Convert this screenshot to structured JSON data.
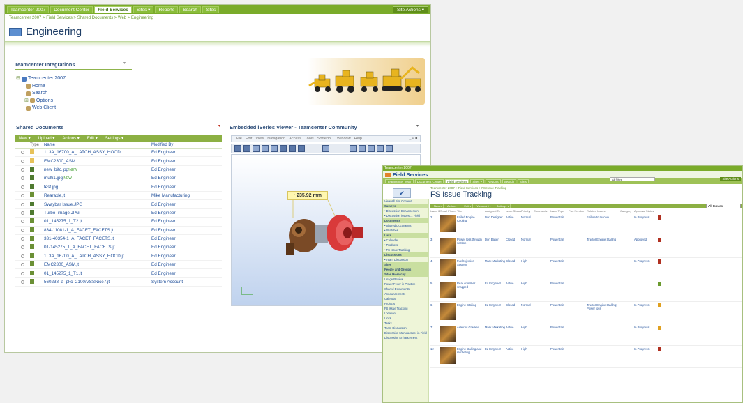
{
  "window1": {
    "top_tabs": [
      "Teamcenter 2007",
      "Document Center",
      "Field Services",
      "Sites ▾",
      "Reports",
      "Search",
      "Sites"
    ],
    "active_tab_index": 2,
    "site_actions": "Site Actions ▾",
    "breadcrumb": "Teamcenter 2007 > Field Services > Shared Documents > Web > Engineering",
    "page_title": "Engineering",
    "integrations": {
      "title": "Teamcenter Integrations",
      "tree": [
        {
          "label": "Teamcenter 2007",
          "indent": 0,
          "glyph": "⊟"
        },
        {
          "label": "Home",
          "indent": 1,
          "glyph": ""
        },
        {
          "label": "Search",
          "indent": 1,
          "glyph": ""
        },
        {
          "label": "Options",
          "indent": 1,
          "glyph": "⊞"
        },
        {
          "label": "Web Client",
          "indent": 1,
          "glyph": ""
        }
      ]
    },
    "shared_documents": {
      "title": "Shared Documents",
      "toolbar": [
        "New ▾",
        "Upload ▾",
        "Actions ▾",
        "Edit ▾",
        "Settings ▾"
      ],
      "columns": {
        "type": "Type",
        "name": "Name",
        "modified_by": "Modified By"
      },
      "rows": [
        {
          "type": "folder",
          "name": "1L3A_16700_A_LATCH_ASSY_HOOD",
          "modified_by": "Ed Engineer",
          "new": false
        },
        {
          "type": "folder",
          "name": "EMC2300_ASM",
          "modified_by": "Ed Engineer",
          "new": false
        },
        {
          "type": "doc",
          "name": "new_bitc.jpg",
          "modified_by": "Ed Engineer",
          "new": true
        },
        {
          "type": "doc",
          "name": "multi1.jpg",
          "modified_by": "Ed Engineer",
          "new": true
        },
        {
          "type": "doc",
          "name": "test.jpg",
          "modified_by": "Ed Engineer",
          "new": false
        },
        {
          "type": "jt",
          "name": "Rearaxle.jt",
          "modified_by": "Mike Manufacturing",
          "new": false
        },
        {
          "type": "doc",
          "name": "Swaybar Issue.JPG",
          "modified_by": "Ed Engineer",
          "new": false
        },
        {
          "type": "doc",
          "name": "Turbo_image.JPG",
          "modified_by": "Ed Engineer",
          "new": false
        },
        {
          "type": "jt",
          "name": "01_145275_1_T2.jt",
          "modified_by": "Ed Engineer",
          "new": false
        },
        {
          "type": "jt",
          "name": "834-11081-1_A_FACET_FACETS.jt",
          "modified_by": "Ed Engineer",
          "new": false
        },
        {
          "type": "jt",
          "name": "331-40354-1_A_FACET_FACETS.jt",
          "modified_by": "Ed Engineer",
          "new": false
        },
        {
          "type": "jt",
          "name": "01-145275_1_A_FACET_FACETS.jt",
          "modified_by": "Ed Engineer",
          "new": false
        },
        {
          "type": "jt",
          "name": "1L3A_16700_A_LATCH_ASSY_HOOD.jt",
          "modified_by": "Ed Engineer",
          "new": false
        },
        {
          "type": "jt",
          "name": "EMC2300_ASM.jt",
          "modified_by": "Ed Engineer",
          "new": false
        },
        {
          "type": "jt",
          "name": "01_145275_1_T1.jt",
          "modified_by": "Ed Engineer",
          "new": false
        },
        {
          "type": "jt",
          "name": "560238_a_pkc_2100/VSSNice7.jt",
          "modified_by": "System Account",
          "new": false
        }
      ],
      "new_marker": "!NEW"
    },
    "viewer": {
      "title": "Embedded iSeries Viewer - Teamcenter Community",
      "menu": [
        "File",
        "Edit",
        "View",
        "Navigation",
        "Access",
        "Tools",
        "Sorted3D",
        "Window",
        "Help"
      ],
      "measurement": "~235.92 mm"
    }
  },
  "window2": {
    "top_bar": "Teamcenter 2007",
    "site_title": "Field Services",
    "tabs": [
      "Teamcenter 2007",
      "Document Center",
      "Field Services",
      "Sites ▾",
      "Reports",
      "Search",
      "Sites"
    ],
    "active_tab_index": 2,
    "site_actions": "Site Actions",
    "search_scope": "All Sites",
    "breadcrumb": "Teamcenter 2007 > Field Services > FS Issue Tracking",
    "page_title": "FS Issue Tracking",
    "toolbar": [
      "New ▾",
      "Actions ▾",
      "Edit ▾",
      "Viewpoint ▾",
      "Settings ▾"
    ],
    "view_selector": "All Issues",
    "columns": [
      "Issue ID",
      "Small Photo",
      "Title",
      "Assigned To",
      "Issue Status",
      "Priority",
      "Comments",
      "Issue Type",
      "Part Number",
      "Related Issues",
      "Category",
      "Approval Status"
    ],
    "rows": [
      {
        "id": "2",
        "title": "Failed Engine Cooling",
        "assigned": "Don Designer",
        "status": "Active",
        "priority": "Normal",
        "type": "Powertrain",
        "issues": "Failure to resolve...",
        "approval": "In Progress",
        "flag": "#b03020"
      },
      {
        "id": "3",
        "title": "Power loss through section",
        "assigned": "Don Baker",
        "status": "Closed",
        "priority": "Normal",
        "type": "Powertrain",
        "issues": "Tractor Engine Stalling",
        "approval": "Approved",
        "flag": "#b03020"
      },
      {
        "id": "4",
        "title": "Fuel Injection System",
        "assigned": "Mark Marketing",
        "status": "Closed",
        "priority": "High",
        "type": "Powertrain",
        "issues": "",
        "approval": "In Progress",
        "flag": "#b03020"
      },
      {
        "id": "5",
        "title": "Rear crossbar snapped",
        "assigned": "Ed Engineer",
        "status": "Active",
        "priority": "High",
        "type": "Powertrain",
        "issues": "",
        "approval": "",
        "flag": "#6a9a2e"
      },
      {
        "id": "6",
        "title": "Engine Stalling",
        "assigned": "Ed Engineer",
        "status": "Closed",
        "priority": "Normal",
        "type": "Powertrain",
        "issues": "Tractor Engine Stalling; Power loss",
        "approval": "In Progress",
        "flag": "#e0a020"
      },
      {
        "id": "7",
        "title": "Axle rod Cracked",
        "assigned": "Mark Marketing",
        "status": "Active",
        "priority": "High",
        "type": "Powertrain",
        "issues": "",
        "approval": "In Progress",
        "flag": "#e0a020"
      },
      {
        "id": "12",
        "title": "Engine stalling and ratcheting",
        "assigned": "Ed Engineer",
        "status": "Active",
        "priority": "High",
        "type": "Powertrain",
        "issues": "",
        "approval": "In Progress",
        "flag": "#b03020"
      }
    ],
    "sidebar": [
      {
        "kind": "it",
        "label": "View All Site Content"
      },
      {
        "kind": "hd",
        "label": "Surveys"
      },
      {
        "kind": "it",
        "label": "• Discussion Enhancement"
      },
      {
        "kind": "it",
        "label": "• Discussion issues ... Field"
      },
      {
        "kind": "hd",
        "label": "Documents"
      },
      {
        "kind": "it",
        "label": "• Shared Documents"
      },
      {
        "kind": "it",
        "label": "• Sketches"
      },
      {
        "kind": "hd",
        "label": "Lists"
      },
      {
        "kind": "it",
        "label": "• Calendar"
      },
      {
        "kind": "it",
        "label": "• Products"
      },
      {
        "kind": "it",
        "label": "• FS Issue Tracking"
      },
      {
        "kind": "hd",
        "label": "Discussions"
      },
      {
        "kind": "it",
        "label": "• Team Discussion"
      },
      {
        "kind": "hd",
        "label": "Sites"
      },
      {
        "kind": "hd",
        "label": "People and Groups"
      },
      {
        "kind": "hd",
        "label": "Sites Hierarchy"
      },
      {
        "kind": "it",
        "label": "Usage Review"
      },
      {
        "kind": "it",
        "label": "Power Fever in Practice"
      },
      {
        "kind": "it",
        "label": "Shared Documents"
      },
      {
        "kind": "it",
        "label": "Announcements"
      },
      {
        "kind": "it",
        "label": "Calendar"
      },
      {
        "kind": "it",
        "label": "Projects"
      },
      {
        "kind": "it",
        "label": "FS Issue Tracking"
      },
      {
        "kind": "it",
        "label": "Location"
      },
      {
        "kind": "it",
        "label": "Links"
      },
      {
        "kind": "it",
        "label": "Tasks"
      },
      {
        "kind": "it",
        "label": "Team Discussion"
      },
      {
        "kind": "it",
        "label": "Discussion Manufacturer in Field"
      },
      {
        "kind": "it",
        "label": "Discussion Enhancement"
      }
    ]
  }
}
